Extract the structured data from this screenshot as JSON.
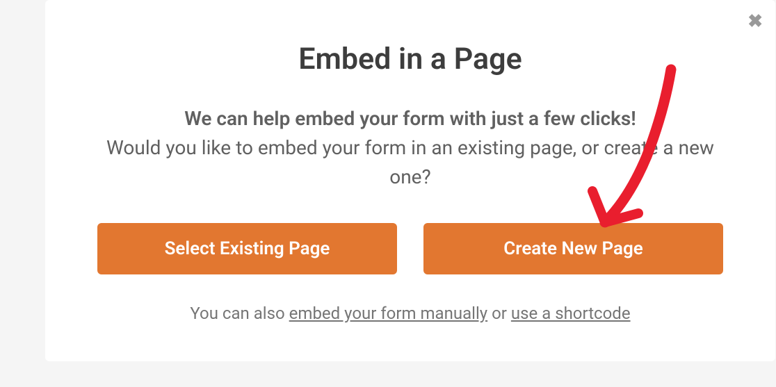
{
  "modal": {
    "title": "Embed in a Page",
    "subtitle_bold": "We can help embed your form with just a few clicks!",
    "subtitle_normal": "Would you like to embed your form in an existing page, or create a new one?",
    "buttons": {
      "select_existing": "Select Existing Page",
      "create_new": "Create New Page"
    },
    "footer": {
      "prefix": "You can also ",
      "link1": "embed your form manually",
      "middle": " or ",
      "link2": "use a shortcode"
    }
  }
}
